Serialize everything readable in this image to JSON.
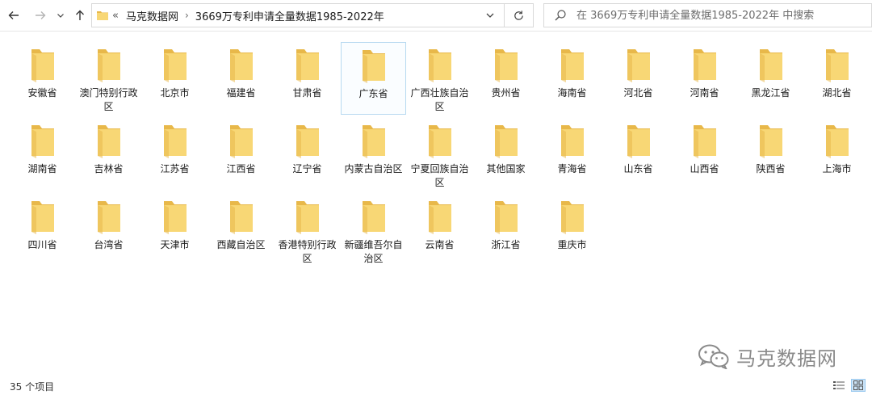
{
  "nav": {
    "back_icon": "arrow-left-icon",
    "forward_icon": "arrow-right-icon",
    "recent_icon": "chevron-down-icon",
    "up_icon": "arrow-up-icon"
  },
  "address": {
    "overflow": "«",
    "crumbs": [
      "马克数据网",
      "3669万专利申请全量数据1985-2022年"
    ]
  },
  "search": {
    "placeholder": "在 3669万专利申请全量数据1985-2022年 中搜索"
  },
  "folders": [
    "安徽省",
    "澳门特别行政区",
    "北京市",
    "福建省",
    "甘肃省",
    "广东省",
    "广西壮族自治区",
    "贵州省",
    "海南省",
    "河北省",
    "河南省",
    "黑龙江省",
    "湖北省",
    "湖南省",
    "吉林省",
    "江苏省",
    "江西省",
    "辽宁省",
    "内蒙古自治区",
    "宁夏回族自治区",
    "其他国家",
    "青海省",
    "山东省",
    "山西省",
    "陕西省",
    "上海市",
    "四川省",
    "台湾省",
    "天津市",
    "西藏自治区",
    "香港特别行政区",
    "新疆维吾尔自治区",
    "云南省",
    "浙江省",
    "重庆市"
  ],
  "selected_folder": "广东省",
  "watermark": {
    "text": "马克数据网",
    "icon": "wechat-icon"
  },
  "status": {
    "count": "35 个项目"
  },
  "colors": {
    "folder": "#f8d775",
    "folder_dark": "#e8b84a",
    "selection": "#b7d9f0"
  }
}
